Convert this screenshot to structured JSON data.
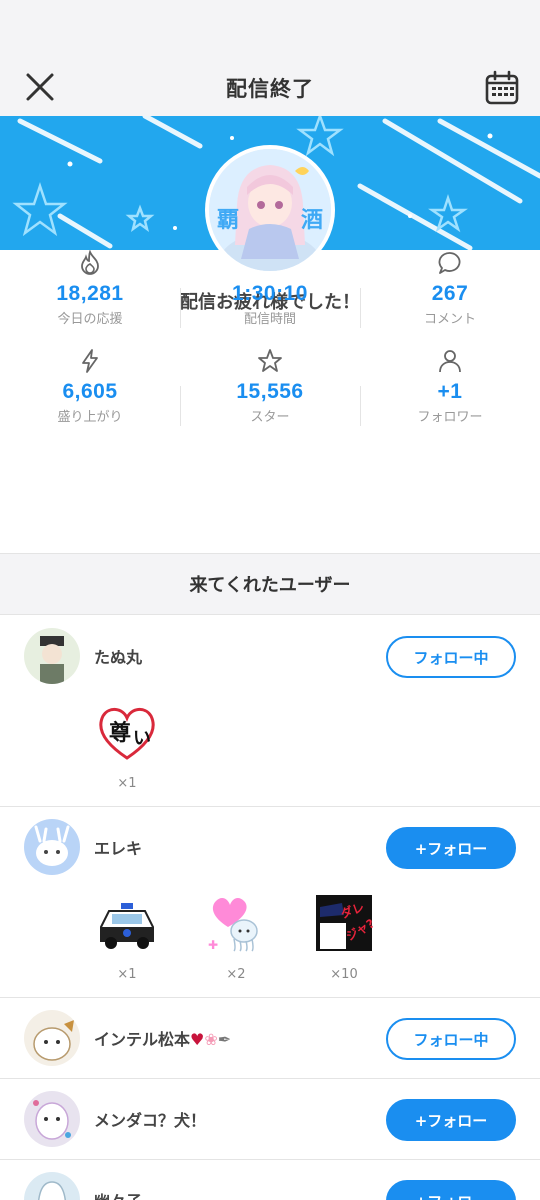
{
  "header": {
    "title": "配信終了",
    "close_icon": "close-icon",
    "calendar_icon": "calendar-icon"
  },
  "colors": {
    "accent": "#1a8ef0",
    "banner": "#22a7ee",
    "section_bg": "#f4f4f6"
  },
  "summary": {
    "message": "配信お疲れ様でした！"
  },
  "stats": [
    {
      "icon": "flame-icon",
      "value": "18,281",
      "label": "今日の応援"
    },
    {
      "icon": "clock-icon",
      "value": "1:30:10",
      "label": "配信時間"
    },
    {
      "icon": "comment-icon",
      "value": "267",
      "label": "コメント"
    },
    {
      "icon": "lightning-icon",
      "value": "6,605",
      "label": "盛り上がり"
    },
    {
      "icon": "star-icon",
      "value": "15,556",
      "label": "スター"
    },
    {
      "icon": "person-icon",
      "value": "+1",
      "label": "フォロワー"
    }
  ],
  "visitors": {
    "heading": "来てくれたユーザー",
    "users": [
      {
        "name": "たぬ丸",
        "button": "フォロー中",
        "gifts": [
          {
            "icon": "heart-stamp-icon",
            "count": "×1"
          }
        ]
      },
      {
        "name": "エレキ",
        "button": "+フォロー",
        "gifts": [
          {
            "icon": "police-car-icon",
            "count": "×1"
          },
          {
            "icon": "jellyfish-heart-icon",
            "count": "×2"
          },
          {
            "icon": "police-sticker-icon",
            "count": "×10"
          }
        ]
      },
      {
        "name": "インテル松本",
        "button": "フォロー中",
        "gifts": []
      },
      {
        "name": "メンダコ？犬！",
        "button": "+フォロー",
        "gifts": []
      },
      {
        "name": "幽々子",
        "button": "+フォロー",
        "gifts": []
      }
    ]
  }
}
